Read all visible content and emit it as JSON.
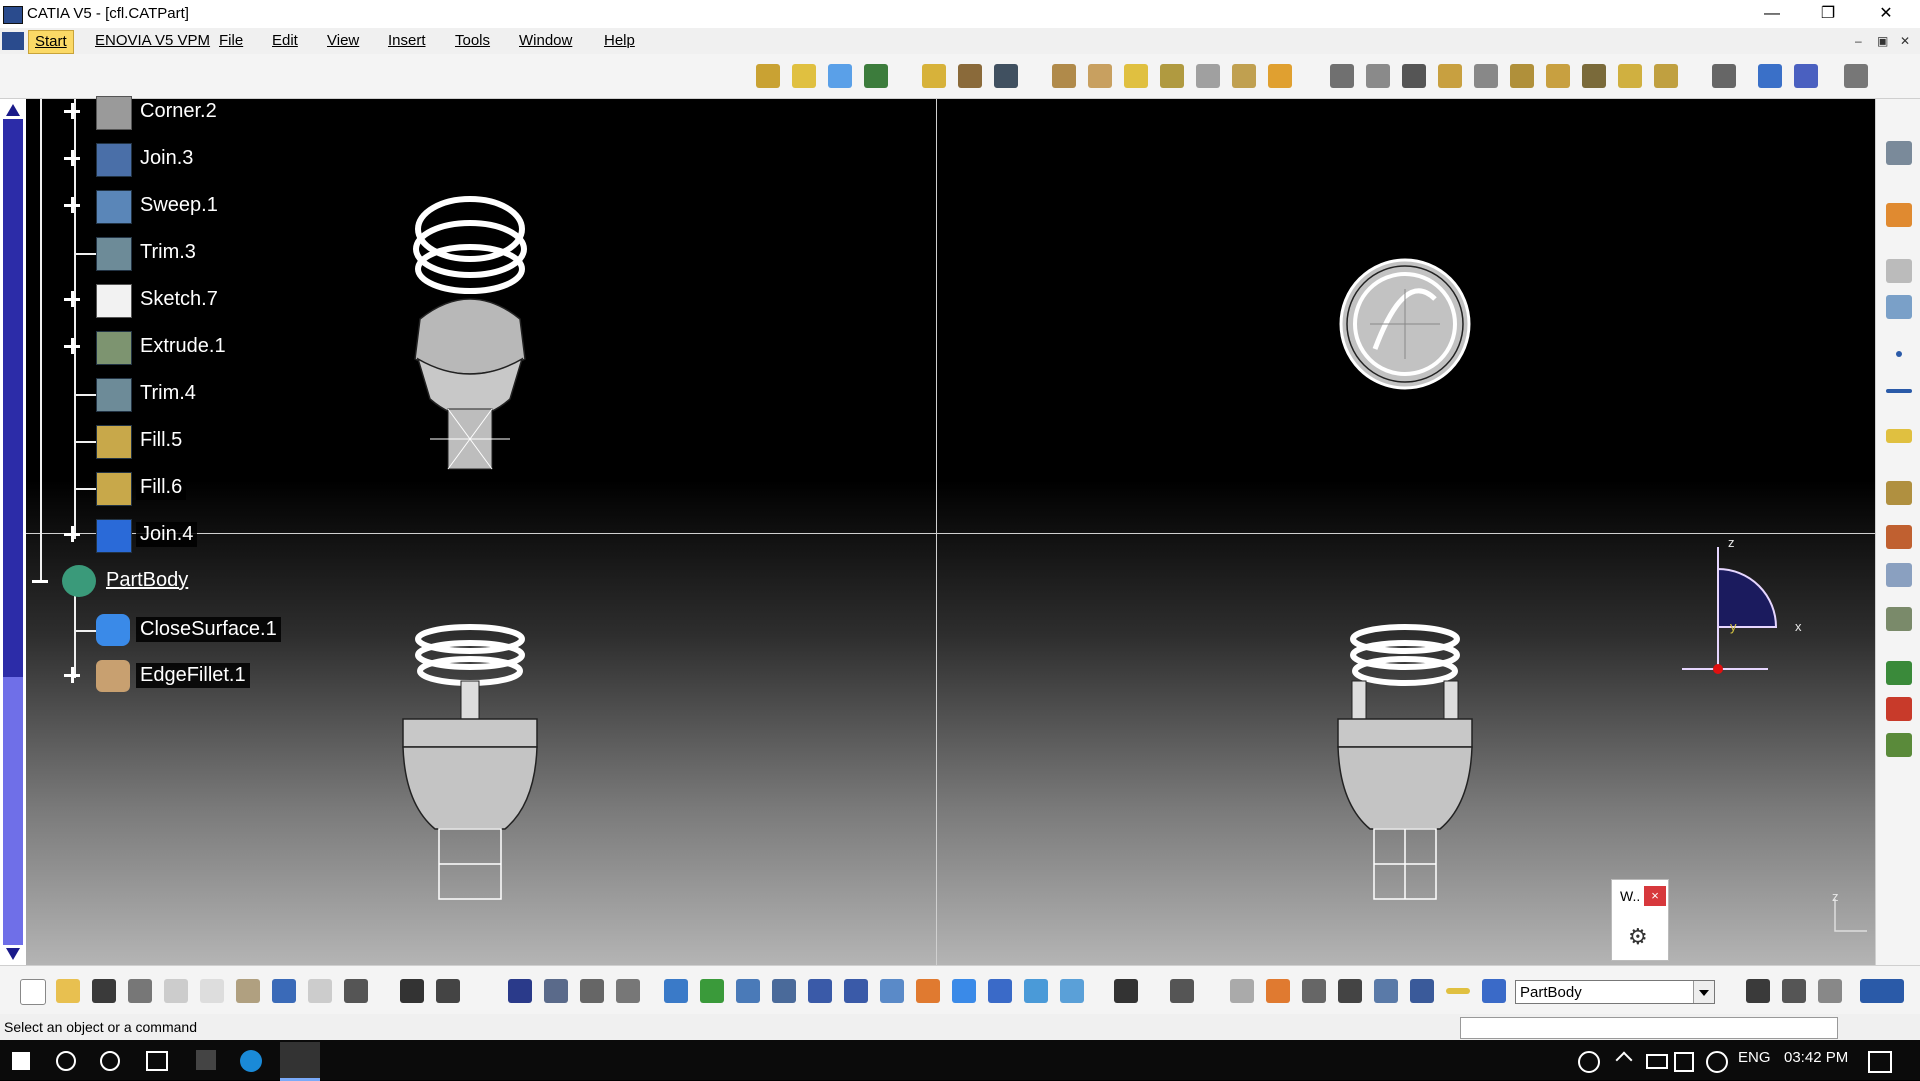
{
  "window": {
    "title": "CATIA V5 - [cfl.CATPart]",
    "minimize": "—",
    "restore": "❐",
    "close": "✕"
  },
  "menu": {
    "items": [
      "Start",
      "ENOVIA V5 VPM",
      "File",
      "Edit",
      "View",
      "Insert",
      "Tools",
      "Window",
      "Help"
    ],
    "mdi_minimize": "–",
    "mdi_restore": "▣",
    "mdi_close": "✕"
  },
  "tree": {
    "nodes": [
      {
        "label": "Corner.2",
        "icon": "corner-icon",
        "expandable": true
      },
      {
        "label": "Join.3",
        "icon": "join-icon",
        "expandable": true
      },
      {
        "label": "Sweep.1",
        "icon": "sweep-icon",
        "expandable": true
      },
      {
        "label": "Trim.3",
        "icon": "trim-icon",
        "expandable": false
      },
      {
        "label": "Sketch.7",
        "icon": "sketch-icon",
        "expandable": true
      },
      {
        "label": "Extrude.1",
        "icon": "extrude-icon",
        "expandable": true
      },
      {
        "label": "Trim.4",
        "icon": "trim-icon",
        "expandable": false
      },
      {
        "label": "Fill.5",
        "icon": "fill-icon",
        "expandable": false
      },
      {
        "label": "Fill.6",
        "icon": "fill-icon",
        "expandable": false
      },
      {
        "label": "Join.4",
        "icon": "join-icon",
        "expandable": true
      }
    ],
    "partbody": {
      "label": "PartBody",
      "icon": "partbody-icon"
    },
    "partbody_children": [
      {
        "label": "CloseSurface.1",
        "icon": "close-surface-icon",
        "expandable": false
      },
      {
        "label": "EdgeFillet.1",
        "icon": "edge-fillet-icon",
        "expandable": true
      }
    ]
  },
  "axes": {
    "z": "z",
    "x": "x",
    "y": "y",
    "corner_z": "z"
  },
  "mini_dialog": {
    "label": "W..",
    "close": "×",
    "gear": "⚙"
  },
  "bottom_toolbar": {
    "current_body": "PartBody"
  },
  "status": {
    "text": "Select an object or a command"
  },
  "taskbar": {
    "language": "ENG",
    "time": "03:42 PM"
  },
  "colors": {
    "accent": "#fbd966",
    "scroll_thumb": "#2c2ca8",
    "scroll_track": "#6f6fe8",
    "close_red": "#d7383c"
  }
}
